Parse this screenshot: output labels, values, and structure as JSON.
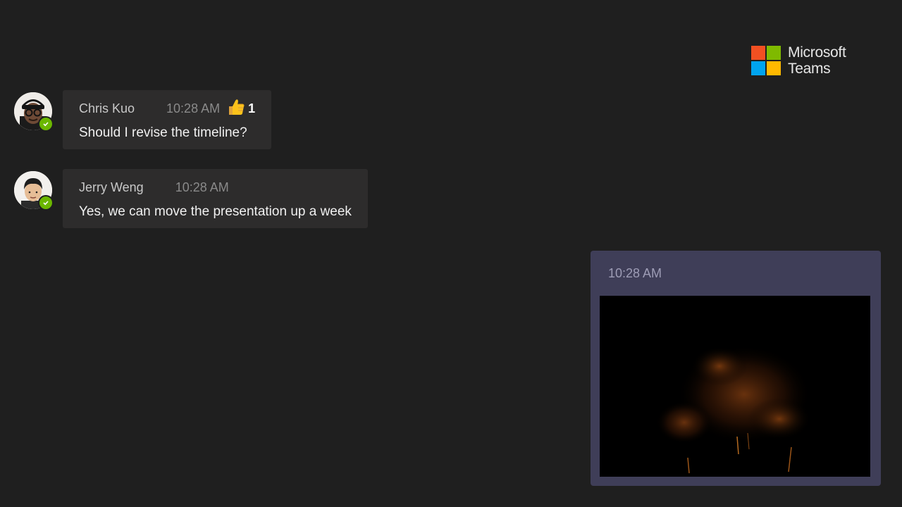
{
  "brand": {
    "name_line1": "Microsoft",
    "name_line2": "Teams",
    "logo_colors": [
      "#f25022",
      "#7fba00",
      "#00a4ef",
      "#ffb900"
    ]
  },
  "messages": [
    {
      "author": "Chris Kuo",
      "time": "10:28 AM",
      "text": "Should I revise the timeline?",
      "reaction": {
        "icon": "thumbs-up-icon",
        "count": "1"
      },
      "presence": "available"
    },
    {
      "author": "Jerry Weng",
      "time": "10:28 AM",
      "text": "Yes, we can move the presentation up a week",
      "presence": "available"
    }
  ],
  "self_message": {
    "time": "10:28 AM",
    "attachment": "video"
  },
  "colors": {
    "background": "#1f1f1f",
    "bubble": "#2d2c2c",
    "self_bubble": "#3f3e58",
    "presence_available": "#6bb700"
  }
}
